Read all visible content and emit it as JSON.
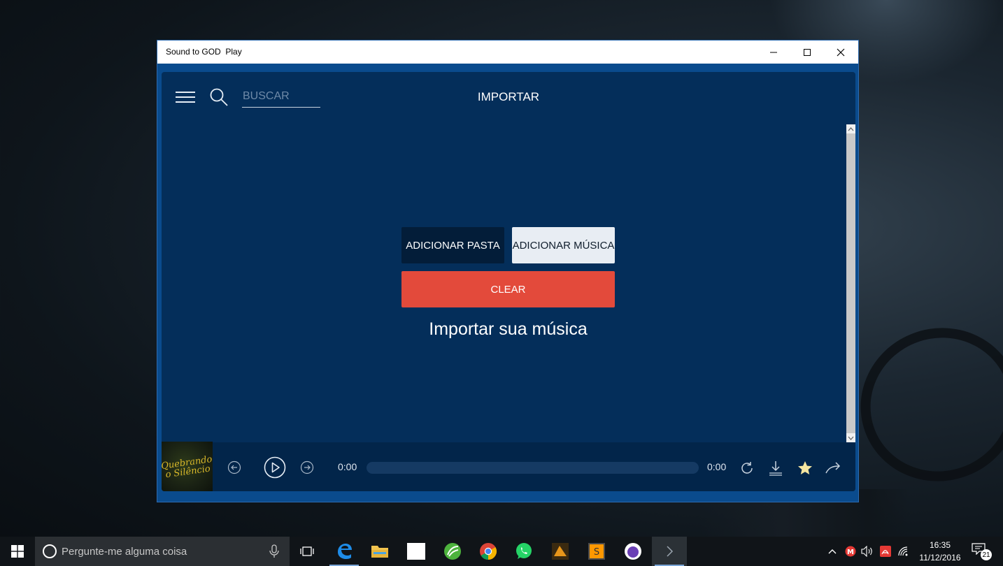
{
  "window": {
    "title": "Sound to GOD  Play",
    "controls": [
      "minimize",
      "maximize",
      "close"
    ]
  },
  "header": {
    "search_placeholder": "BUSCAR",
    "page_title": "IMPORTAR"
  },
  "main": {
    "add_folder_label": "ADICIONAR PASTA",
    "add_music_label": "ADICIONAR MÚSICA",
    "clear_label": "CLEAR",
    "import_text": "Importar sua música"
  },
  "player": {
    "album_text": "Quebrando o Silêncio",
    "current_time": "0:00",
    "total_time": "0:00",
    "progress": 0,
    "icons": [
      "rewind-icon",
      "play-icon",
      "forward-icon",
      "repeat-icon",
      "download-icon",
      "star-icon",
      "share-icon"
    ]
  },
  "taskbar": {
    "search_placeholder": "Pergunte-me alguma coisa",
    "clock_time": "16:35",
    "clock_date": "11/12/2016",
    "notification_count": "21"
  },
  "colors": {
    "app_bg": "#042e5a",
    "window_border": "#0a4b8d",
    "clear_button": "#e34a3b",
    "folder_button": "#031d39",
    "music_button": "#e8edf3",
    "star": "#f5e6a0"
  }
}
